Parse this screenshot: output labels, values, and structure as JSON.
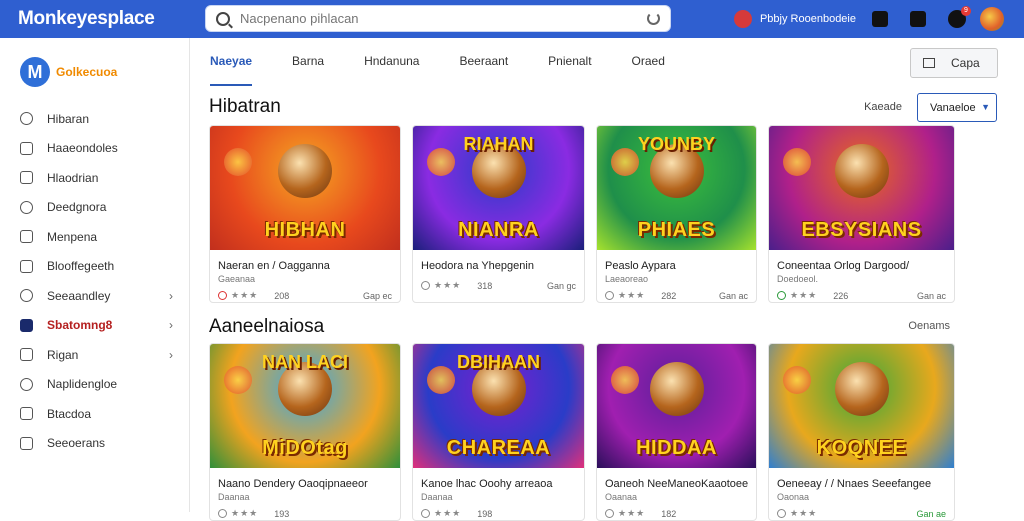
{
  "topbar": {
    "brand": "Monkeyesplace",
    "search_placeholder": "Nacpenano pihlacan",
    "user_label": "Pbbjy Rooenbodeie",
    "notification_count": "9"
  },
  "sidebar": {
    "logo_mark": "M",
    "logo_text": "Golkecuoa",
    "items": [
      {
        "label": "Hibaran",
        "icon": "search-icon",
        "chevron": ""
      },
      {
        "label": "Haaeondoles",
        "icon": "star-icon",
        "chevron": ""
      },
      {
        "label": "Hlaodrian",
        "icon": "chat-icon",
        "chevron": ""
      },
      {
        "label": "Deedgnora",
        "icon": "refresh-icon",
        "chevron": ""
      },
      {
        "label": "Menpena",
        "icon": "square-icon",
        "chevron": ""
      },
      {
        "label": "Blooffegeeth",
        "icon": "file-icon",
        "chevron": ""
      },
      {
        "label": "Seeaandley",
        "icon": "gear-icon",
        "chevron": "›"
      },
      {
        "label": "Sbatomng8",
        "icon": "app-icon",
        "chevron": "›"
      },
      {
        "label": "Rigan",
        "icon": "grid-icon",
        "chevron": "›"
      },
      {
        "label": "Naplidengloe",
        "icon": "bell-icon",
        "chevron": ""
      },
      {
        "label": "Btacdoa",
        "icon": "flag-icon",
        "chevron": ""
      },
      {
        "label": "Seeoerans",
        "icon": "settings-icon",
        "chevron": ""
      }
    ],
    "active_index": 7
  },
  "tabs": [
    "Naeyae",
    "Barna",
    "Hndanuna",
    "Beeraant",
    "Pnienalt",
    "Oraed"
  ],
  "active_tab": 0,
  "filter_label": "Capa",
  "section1": {
    "title": "Hibatran",
    "sort_label": "Kaeade",
    "sort_value": "Vanaeloe"
  },
  "section2": {
    "title": "Aaneelnaiosa",
    "see_all": "Oenams"
  },
  "row1": [
    {
      "title": "Naeran en / Oagganna",
      "sub": "Gaeanaa",
      "stars": "★★★",
      "downloads": "208",
      "price": "Gap ec",
      "art_text": "HIBHAN",
      "dot": "red"
    },
    {
      "title": "Heodora na Yhepgenin",
      "sub": "",
      "stars": "★★★",
      "downloads": "318",
      "price": "Gan gc",
      "art_text": "NIANRA",
      "art_top": "RIAHAN",
      "dot": ""
    },
    {
      "title": "Peaslo Aypara",
      "sub": "Laeaoreao",
      "stars": "★★★",
      "downloads": "282",
      "price": "Gan ac",
      "art_text": "PHIAES",
      "art_top": "YOUNBY",
      "dot": ""
    },
    {
      "title": "Coneentaa Orlog Dargood/",
      "sub": "Doedoeol.",
      "stars": "★★★",
      "downloads": "226",
      "price": "Gan ac",
      "art_text": "EBSYSIANS",
      "dot": "green"
    }
  ],
  "row2": [
    {
      "title": "Naano Dendery Oaoqipnaeeor",
      "sub": "Daanaa",
      "stars": "★★★",
      "downloads": "193",
      "price": "",
      "art_text": "MiDOtag",
      "art_top": "NAN LACI"
    },
    {
      "title": "Kanoe lhac Ooohy arreaoa",
      "sub": "Daanaa",
      "stars": "★★★",
      "downloads": "198",
      "price": "",
      "art_text": "CHAREAA",
      "art_top": "DBIHAAN"
    },
    {
      "title": "Oaneoh NeeManeoKaaotoee",
      "sub": "Oaanaa",
      "stars": "★★★",
      "downloads": "182",
      "price": "",
      "art_text": "HIDDAA"
    },
    {
      "title": "Oeneeay / / Nnaes Seeefangee",
      "sub": "Oaonaa",
      "stars": "★★★",
      "downloads": "",
      "price": "Gan ae",
      "art_text": "KOQNEE"
    }
  ]
}
